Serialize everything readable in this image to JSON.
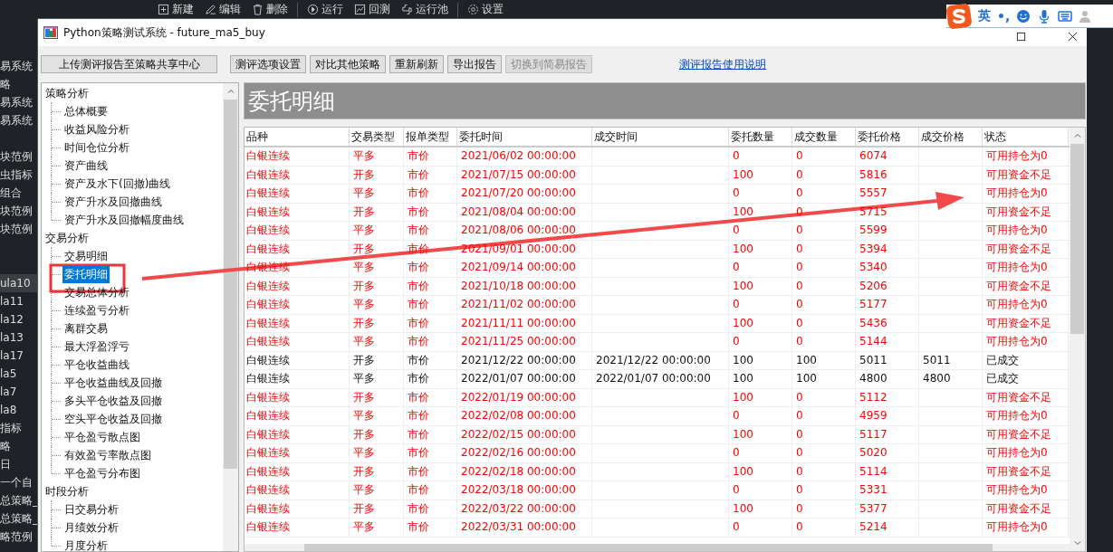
{
  "toolbar": [
    {
      "label": "新建"
    },
    {
      "label": "编辑"
    },
    {
      "label": "删除"
    },
    {
      "label": "运行"
    },
    {
      "label": "回测"
    },
    {
      "label": "运行池"
    },
    {
      "label": "设置"
    }
  ],
  "side_list": {
    "groups": [
      [
        {
          "label": "易系统",
          "selected": false
        },
        {
          "label": "略",
          "selected": false
        },
        {
          "label": "易系统",
          "selected": false
        },
        {
          "label": "易系统",
          "selected": false
        }
      ],
      [
        {
          "label": "块范例",
          "selected": false
        },
        {
          "label": "虫指标",
          "selected": false
        },
        {
          "label": "组合",
          "selected": false
        },
        {
          "label": "块范例",
          "selected": false
        },
        {
          "label": "块范例",
          "selected": false
        }
      ],
      [
        {
          "label": "ula10",
          "selected": true
        },
        {
          "label": "la11",
          "selected": false
        },
        {
          "label": "la12",
          "selected": false
        },
        {
          "label": "la13",
          "selected": false
        },
        {
          "label": "la17",
          "selected": false
        },
        {
          "label": "la5",
          "selected": false
        },
        {
          "label": "la7",
          "selected": false
        },
        {
          "label": "la8",
          "selected": false
        },
        {
          "label": "指标",
          "selected": false
        },
        {
          "label": "略",
          "selected": false
        },
        {
          "label": "日",
          "selected": false
        },
        {
          "label": "一个自",
          "selected": false
        },
        {
          "label": "总策略_",
          "selected": false
        },
        {
          "label": "总策略_",
          "selected": false
        },
        {
          "label": "略范例",
          "selected": false
        }
      ]
    ]
  },
  "ime_toolbar": {
    "mode": "英",
    "punctuation": "•,"
  },
  "window": {
    "title": "Python策略测试系统 - future_ma5_buy"
  },
  "buttons": [
    {
      "label": "上传测评报告至策略共享中心",
      "disabled": false
    },
    {
      "label": "测评选项设置",
      "disabled": false
    },
    {
      "label": "对比其他策略",
      "disabled": false
    },
    {
      "label": "重新刷新",
      "disabled": false
    },
    {
      "label": "导出报告",
      "disabled": false
    },
    {
      "label": "切换到简易报告",
      "disabled": true
    }
  ],
  "help_link": "测评报告使用说明",
  "tree": [
    {
      "label": "策略分析",
      "children": [
        {
          "label": "总体概要",
          "selected": false
        },
        {
          "label": "收益风险分析",
          "selected": false
        },
        {
          "label": "时间仓位分析",
          "selected": false
        },
        {
          "label": "资产曲线",
          "selected": false
        },
        {
          "label": "资产及水下(回撤)曲线",
          "selected": false
        },
        {
          "label": "资产升水及回撤曲线",
          "selected": false
        },
        {
          "label": "资产升水及回撤幅度曲线",
          "selected": false
        }
      ]
    },
    {
      "label": "交易分析",
      "children": [
        {
          "label": "交易明细",
          "selected": false
        },
        {
          "label": "委托明细",
          "selected": true
        },
        {
          "label": "交易总体分析",
          "selected": false
        },
        {
          "label": "连续盈亏分析",
          "selected": false
        },
        {
          "label": "离群交易",
          "selected": false
        },
        {
          "label": "最大浮盈浮亏",
          "selected": false
        },
        {
          "label": "平仓收益曲线",
          "selected": false
        },
        {
          "label": "平仓收益曲线及回撤",
          "selected": false
        },
        {
          "label": "多头平仓收益及回撤",
          "selected": false
        },
        {
          "label": "空头平仓收益及回撤",
          "selected": false
        },
        {
          "label": "平仓盈亏散点图",
          "selected": false
        },
        {
          "label": "有效盈亏率散点图",
          "selected": false
        },
        {
          "label": "平仓盈亏分布图",
          "selected": false
        }
      ]
    },
    {
      "label": "时段分析",
      "children": [
        {
          "label": "日交易分析",
          "selected": false
        },
        {
          "label": "月绩效分析",
          "selected": false
        },
        {
          "label": "月度分析",
          "selected": false
        }
      ]
    }
  ],
  "report": {
    "title": "委托明细",
    "columns": [
      "品种",
      "交易类型",
      "报单类型",
      "委托时间",
      "成交时间",
      "委托数量",
      "成交数量",
      "委托价格",
      "成交价格",
      "状态"
    ],
    "rows": [
      {
        "failed": true,
        "cells": [
          "白银连续",
          "平多",
          "市价",
          "2021/06/02 00:00:00",
          "",
          "0",
          "0",
          "6074",
          "",
          "可用持仓为0"
        ]
      },
      {
        "failed": true,
        "cells": [
          "白银连续",
          "开多",
          "市价",
          "2021/07/15 00:00:00",
          "",
          "100",
          "0",
          "5816",
          "",
          "可用资金不足"
        ]
      },
      {
        "failed": true,
        "cells": [
          "白银连续",
          "平多",
          "市价",
          "2021/07/20 00:00:00",
          "",
          "0",
          "0",
          "5557",
          "",
          "可用持仓为0"
        ]
      },
      {
        "failed": true,
        "cells": [
          "白银连续",
          "开多",
          "市价",
          "2021/08/04 00:00:00",
          "",
          "100",
          "0",
          "5715",
          "",
          "可用资金不足"
        ]
      },
      {
        "failed": true,
        "cells": [
          "白银连续",
          "平多",
          "市价",
          "2021/08/06 00:00:00",
          "",
          "0",
          "0",
          "5599",
          "",
          "可用持仓为0"
        ]
      },
      {
        "failed": true,
        "cells": [
          "白银连续",
          "开多",
          "市价",
          "2021/09/01 00:00:00",
          "",
          "100",
          "0",
          "5394",
          "",
          "可用资金不足"
        ]
      },
      {
        "failed": true,
        "cells": [
          "白银连续",
          "平多",
          "市价",
          "2021/09/14 00:00:00",
          "",
          "0",
          "0",
          "5340",
          "",
          "可用持仓为0"
        ]
      },
      {
        "failed": true,
        "cells": [
          "白银连续",
          "开多",
          "市价",
          "2021/10/18 00:00:00",
          "",
          "100",
          "0",
          "5206",
          "",
          "可用资金不足"
        ]
      },
      {
        "failed": true,
        "cells": [
          "白银连续",
          "平多",
          "市价",
          "2021/11/02 00:00:00",
          "",
          "0",
          "0",
          "5177",
          "",
          "可用持仓为0"
        ]
      },
      {
        "failed": true,
        "cells": [
          "白银连续",
          "开多",
          "市价",
          "2021/11/11 00:00:00",
          "",
          "100",
          "0",
          "5436",
          "",
          "可用资金不足"
        ]
      },
      {
        "failed": true,
        "cells": [
          "白银连续",
          "平多",
          "市价",
          "2021/11/25 00:00:00",
          "",
          "0",
          "0",
          "5144",
          "",
          "可用持仓为0"
        ]
      },
      {
        "failed": false,
        "cells": [
          "白银连续",
          "开多",
          "市价",
          "2021/12/22 00:00:00",
          "2021/12/22 00:00:00",
          "100",
          "100",
          "5011",
          "5011",
          "已成交"
        ]
      },
      {
        "failed": false,
        "cells": [
          "白银连续",
          "平多",
          "市价",
          "2022/01/07 00:00:00",
          "2022/01/07 00:00:00",
          "100",
          "100",
          "4800",
          "4800",
          "已成交"
        ]
      },
      {
        "failed": true,
        "cells": [
          "白银连续",
          "开多",
          "市价",
          "2022/01/19 00:00:00",
          "",
          "100",
          "0",
          "5112",
          "",
          "可用资金不足"
        ]
      },
      {
        "failed": true,
        "cells": [
          "白银连续",
          "平多",
          "市价",
          "2022/02/08 00:00:00",
          "",
          "0",
          "0",
          "4959",
          "",
          "可用持仓为0"
        ]
      },
      {
        "failed": true,
        "cells": [
          "白银连续",
          "开多",
          "市价",
          "2022/02/15 00:00:00",
          "",
          "100",
          "0",
          "5117",
          "",
          "可用资金不足"
        ]
      },
      {
        "failed": true,
        "cells": [
          "白银连续",
          "平多",
          "市价",
          "2022/02/16 00:00:00",
          "",
          "0",
          "0",
          "5020",
          "",
          "可用持仓为0"
        ]
      },
      {
        "failed": true,
        "cells": [
          "白银连续",
          "开多",
          "市价",
          "2022/02/18 00:00:00",
          "",
          "100",
          "0",
          "5114",
          "",
          "可用资金不足"
        ]
      },
      {
        "failed": true,
        "cells": [
          "白银连续",
          "平多",
          "市价",
          "2022/03/18 00:00:00",
          "",
          "0",
          "0",
          "5331",
          "",
          "可用持仓为0"
        ]
      },
      {
        "failed": true,
        "cells": [
          "白银连续",
          "开多",
          "市价",
          "2022/03/22 00:00:00",
          "",
          "100",
          "0",
          "5377",
          "",
          "可用资金不足"
        ]
      },
      {
        "failed": true,
        "cells": [
          "白银连续",
          "平多",
          "市价",
          "2022/03/31 00:00:00",
          "",
          "0",
          "0",
          "5214",
          "",
          "可用持仓为0"
        ]
      }
    ]
  }
}
